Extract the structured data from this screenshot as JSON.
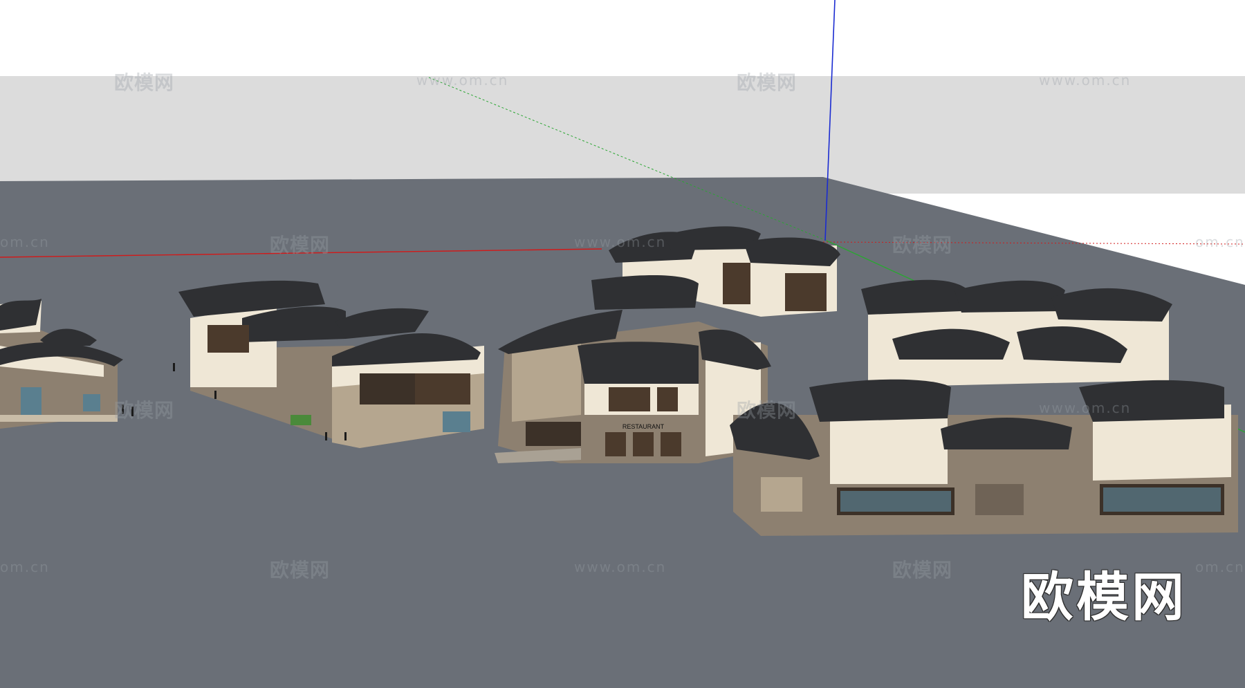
{
  "scene": {
    "colors": {
      "sky": "#ffffff",
      "horizon_band": "#dcdcdc",
      "ground": "#6a6f77",
      "roof": "#2f3033",
      "wall": "#efe7d6",
      "stone": "#8d8070",
      "wood": "#4b3a2c",
      "window": "#5a7f8f",
      "axis_red": "#d11a1a",
      "axis_green": "#2aa632",
      "axis_blue": "#1a2bd1"
    },
    "buildings": [
      {
        "name": "left-edge-house-group"
      },
      {
        "name": "west-courtyard-complex"
      },
      {
        "name": "central-restaurant-complex"
      },
      {
        "name": "north-hillside-houses"
      },
      {
        "name": "east-residence-complex"
      }
    ],
    "restaurant_sign": "RESTAURANT"
  },
  "watermarks": {
    "cn_text": "欧模网",
    "url_text": "www.om.cn",
    "url_partial": "om.cn"
  },
  "brand_logo": "欧模网"
}
